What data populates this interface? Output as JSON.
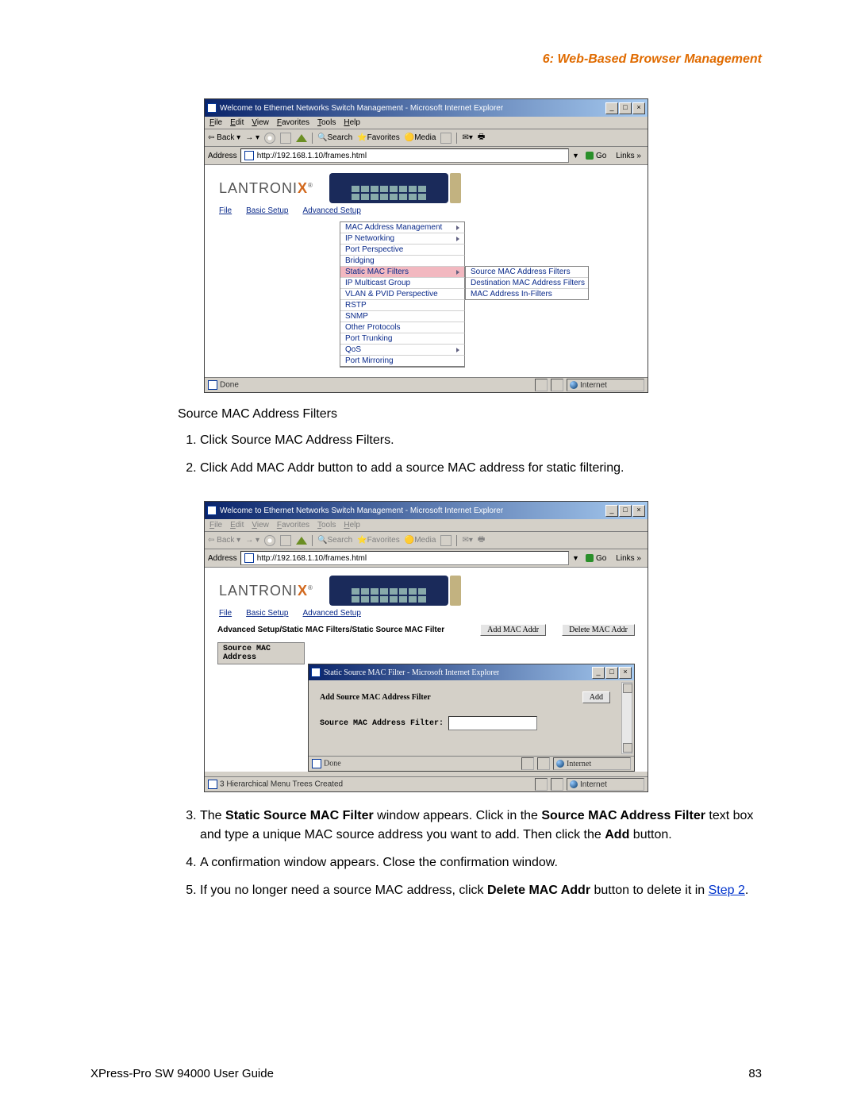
{
  "chapter_header": "6: Web-Based Browser Management",
  "section_heading": "Source MAC Address Filters",
  "steps": {
    "s1": "Click Source MAC Address Filters.",
    "s2": "Click Add MAC Addr button to add a source MAC address for static filtering.",
    "s3_pre": "The ",
    "s3_b1": "Static Source MAC Filter",
    "s3_mid1": " window appears. Click in the ",
    "s3_b2": "Source MAC Address Filter",
    "s3_mid2": " text box and type a unique MAC source address you want to add. Then click the ",
    "s3_b3": "Add",
    "s3_post": " button.",
    "s4": "A confirmation window appears. Close the confirmation window.",
    "s5_pre": "If you no longer need a source MAC address, click ",
    "s5_b1": "Delete MAC Addr",
    "s5_mid": " button to delete it in ",
    "s5_link": "Step 2",
    "s5_post": "."
  },
  "footer_left": "XPress-Pro SW 94000 User Guide",
  "footer_right": "83",
  "ie": {
    "title": "Welcome to Ethernet Networks Switch Management - Microsoft Internet Explorer",
    "menus": [
      "File",
      "Edit",
      "View",
      "Favorites",
      "Tools",
      "Help"
    ],
    "back": "Back",
    "search": "Search",
    "favorites": "Favorites",
    "media": "Media",
    "addr_label": "Address",
    "url": "http://192.168.1.10/frames.html",
    "go": "Go",
    "links": "Links",
    "done": "Done",
    "internet": "Internet",
    "status2": "3 Hierarchical Menu Trees Created"
  },
  "brand": "LANTRONIX",
  "nav": {
    "file": "File",
    "basic": "Basic Setup",
    "adv": "Advanced Setup"
  },
  "adv_menu": [
    "MAC Address Management",
    "IP Networking",
    "Port Perspective",
    "Bridging",
    "Static MAC Filters",
    "IP Multicast Group",
    "VLAN & PVID Perspective",
    "RSTP",
    "SNMP",
    "Other Protocols",
    "Port Trunking",
    "QoS",
    "Port Mirroring"
  ],
  "sub_menu": [
    "Source MAC Address Filters",
    "Destination MAC Address Filters",
    "MAC Address In-Filters"
  ],
  "shot2": {
    "breadcrumb": "Advanced Setup/Static MAC Filters/Static Source MAC Filter",
    "add_btn": "Add MAC Addr",
    "del_btn": "Delete MAC Addr",
    "col_head": "Source MAC Address",
    "dlg_title": "Static Source MAC Filter - Microsoft Internet Explorer",
    "dlg_heading": "Add Source MAC Address Filter",
    "dlg_add": "Add",
    "dlg_label": "Source MAC Address Filter:"
  }
}
